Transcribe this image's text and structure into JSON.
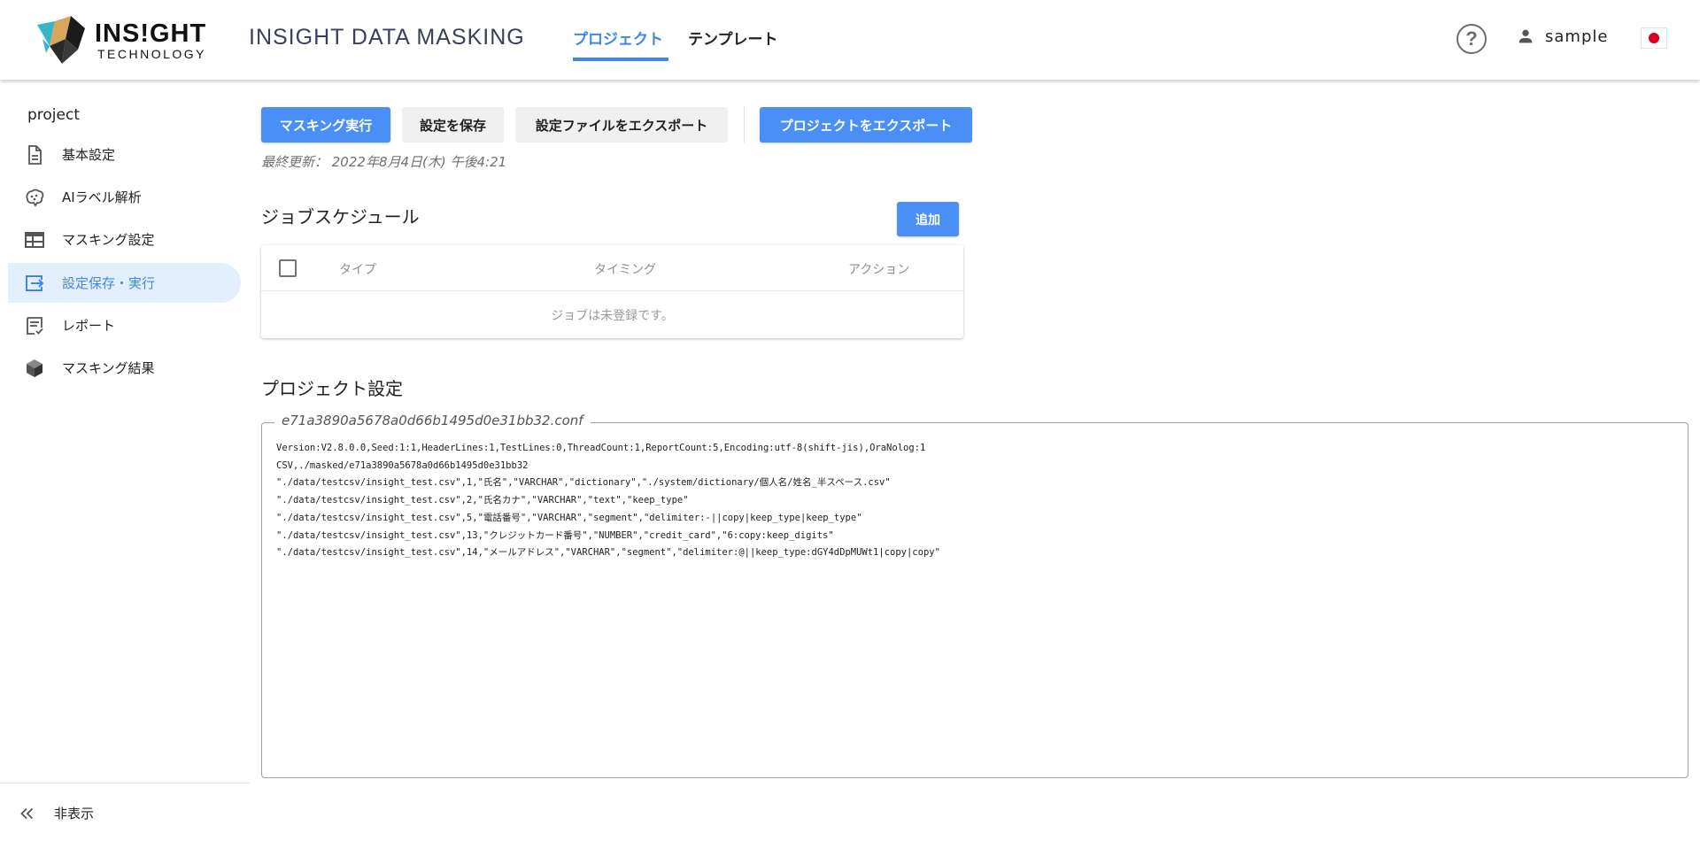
{
  "header": {
    "logo_word": "INS!GHT",
    "logo_sub": "TECHNOLOGY",
    "product_title": "INSIGHT DATA MASKING",
    "tabs": [
      {
        "label": "プロジェクト",
        "active": true
      },
      {
        "label": "テンプレート",
        "active": false
      }
    ],
    "help_symbol": "?",
    "user_name": "sample",
    "language_flag": "japan-flag-icon"
  },
  "sidebar": {
    "project_name": "project",
    "items": [
      {
        "label": "基本設定",
        "icon": "document-icon",
        "active": false
      },
      {
        "label": "AIラベル解析",
        "icon": "brain-icon",
        "active": false
      },
      {
        "label": "マスキング設定",
        "icon": "table-icon",
        "active": false
      },
      {
        "label": "設定保存・実行",
        "icon": "export-icon",
        "active": true
      },
      {
        "label": "レポート",
        "icon": "report-icon",
        "active": false
      },
      {
        "label": "マスキング結果",
        "icon": "cube-icon",
        "active": false
      }
    ],
    "collapse_label": "非表示"
  },
  "toolbar": {
    "run_label": "マスキング実行",
    "save_label": "設定を保存",
    "export_config_label": "設定ファイルをエクスポート",
    "export_project_label": "プロジェクトをエクスポート",
    "last_updated": "最終更新： 2022年8月4日(木) 午後4:21"
  },
  "jobs": {
    "title": "ジョブスケジュール",
    "add_label": "追加",
    "columns": [
      "タイプ",
      "タイミング",
      "アクション"
    ],
    "rows": [],
    "empty_message": "ジョブは未登録です。"
  },
  "project_settings": {
    "title": "プロジェクト設定",
    "file_name": "e71a3890a5678a0d66b1495d0e31bb32.conf",
    "lines": [
      "Version:V2.8.0.0,Seed:1:1,HeaderLines:1,TestLines:0,ThreadCount:1,ReportCount:5,Encoding:utf-8(shift-jis),OraNolog:1",
      "CSV,./masked/e71a3890a5678a0d66b1495d0e31bb32",
      "\"./data/testcsv/insight_test.csv\",1,\"氏名\",\"VARCHAR\",\"dictionary\",\"./system/dictionary/個人名/姓名_半スペース.csv\"",
      "\"./data/testcsv/insight_test.csv\",2,\"氏名カナ\",\"VARCHAR\",\"text\",\"keep_type\"",
      "\"./data/testcsv/insight_test.csv\",5,\"電話番号\",\"VARCHAR\",\"segment\",\"delimiter:-||copy|keep_type|keep_type\"",
      "\"./data/testcsv/insight_test.csv\",13,\"クレジットカード番号\",\"NUMBER\",\"credit_card\",\"6:copy:keep_digits\"",
      "\"./data/testcsv/insight_test.csv\",14,\"メールアドレス\",\"VARCHAR\",\"segment\",\"delimiter:@||keep_type:dGY4dDpMUWt1|copy|copy\""
    ]
  },
  "colors": {
    "accent": "#3d86f0",
    "primary_button": "#4a8ff5",
    "active_nav_bg": "#e3effd"
  }
}
